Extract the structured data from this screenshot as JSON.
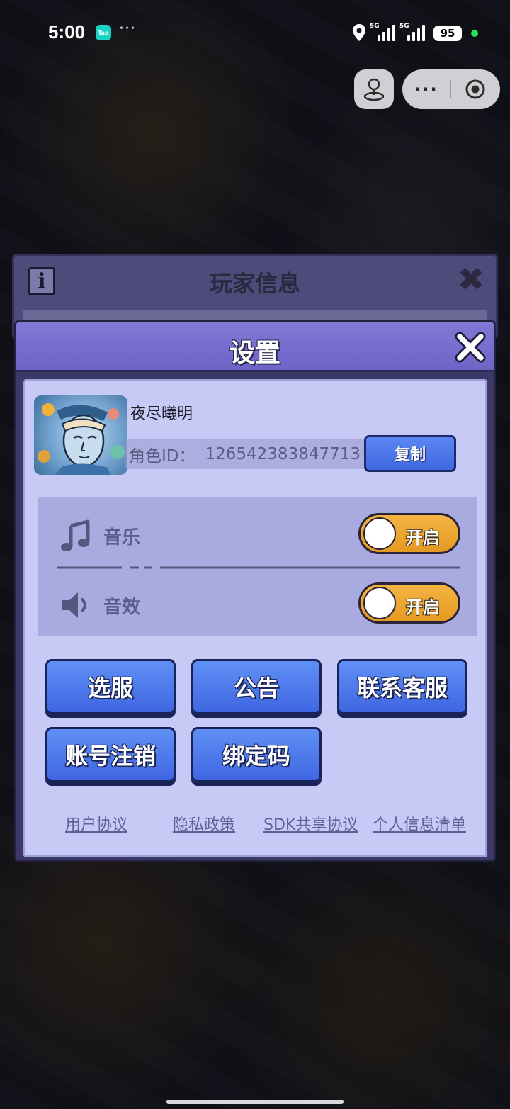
{
  "status_bar": {
    "time": "5:00",
    "tap_badge": "Tap",
    "dots": "···",
    "signal1": "5G",
    "signal2": "5G",
    "battery": "95",
    "icons": [
      "location-icon",
      "signal-icon",
      "battery-icon"
    ]
  },
  "capsule": {
    "more": "···",
    "icons": [
      "joystick-icon",
      "more-icon",
      "record-icon"
    ]
  },
  "back_panel": {
    "info_icon": "i",
    "title": "玩家信息",
    "close": "✖"
  },
  "dialog": {
    "title": "设置",
    "close_icon": "close-icon"
  },
  "profile": {
    "name": "夜尽曦明",
    "role_id_label": "角色ID：",
    "role_id_value": "126542383847713",
    "copy_label": "复制"
  },
  "sound": {
    "music": {
      "label": "音乐",
      "state": "开启",
      "on": true,
      "icon": "music-note-icon"
    },
    "sfx": {
      "label": "音效",
      "state": "开启",
      "on": true,
      "icon": "speaker-icon"
    }
  },
  "buttons": {
    "select_server": "选服",
    "announcement": "公告",
    "contact_support": "联系客服",
    "delete_account": "账号注销",
    "bind_code": "绑定码"
  },
  "links": {
    "user_agreement": "用户协议",
    "privacy_policy": "隐私政策",
    "sdk_sharing": "SDK共享协议",
    "personal_info_list": "个人信息清单"
  },
  "colors": {
    "dialog_header": "#7a70d2",
    "dialog_body": "#c8caf6",
    "primary_button": "#4f78ec",
    "toggle_on": "#f0aa36"
  }
}
